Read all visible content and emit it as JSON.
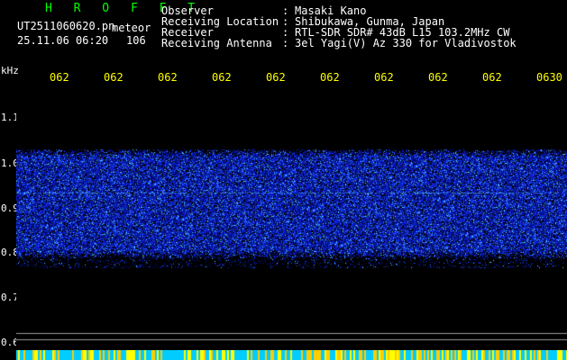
{
  "header": {
    "brand": "H R O F F T",
    "filename": "UT2511060620.pn",
    "type_label": "meteor",
    "datetime": "25.11.06 06:20",
    "count": "106"
  },
  "meta": [
    {
      "label": "Observer",
      "sep": ":",
      "value": "Masaki Kano"
    },
    {
      "label": "Receiving Location",
      "sep": ":",
      "value": "Shibukawa, Gunma, Japan"
    },
    {
      "label": "Receiver",
      "sep": ":",
      "value": "RTL-SDR SDR# 43dB L15 103.2MHz CW"
    },
    {
      "label": "Receiving Antenna",
      "sep": ":",
      "value": "3el Yagi(V) Az 330 for Vladivostok"
    }
  ],
  "axis": {
    "unit": "kHz",
    "time_ticks": [
      "062",
      "062",
      "062",
      "062",
      "062",
      "062",
      "062",
      "062",
      "062",
      "0630"
    ],
    "freq_ticks": [
      "1.1",
      "1.0",
      "0.9",
      "0.8",
      "0.7",
      "0.6"
    ]
  },
  "colors": {
    "background": "#000000",
    "brand": "#00ff00",
    "time_ticks": "#ffff00",
    "signal": "#1e3cff"
  }
}
